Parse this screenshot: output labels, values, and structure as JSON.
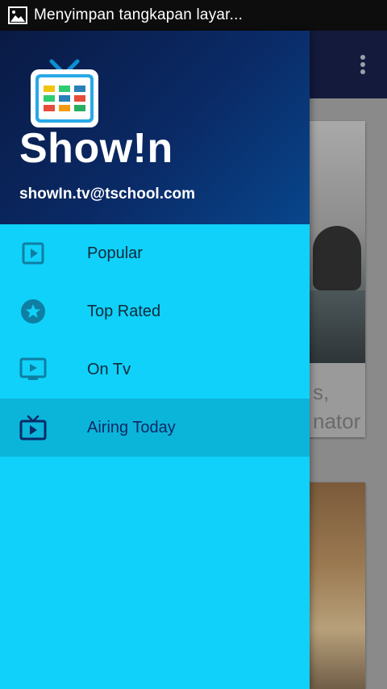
{
  "status_bar": {
    "notification_text": "Menyimpan tangkapan layar..."
  },
  "background": {
    "card_caption_lines": [
      "s,",
      "nator"
    ]
  },
  "drawer": {
    "app_name": "Show!n",
    "account_email": "showIn.tv@tschool.com",
    "items": [
      {
        "label": "Popular",
        "icon": "play-square-icon",
        "active": false
      },
      {
        "label": "Top Rated",
        "icon": "star-circle-icon",
        "active": false
      },
      {
        "label": "On Tv",
        "icon": "monitor-play-icon",
        "active": false
      },
      {
        "label": "Airing Today",
        "icon": "tv-antenna-icon",
        "active": true
      }
    ]
  },
  "colors": {
    "drawer_bg": "#10d1f9",
    "active_item_bg": "#0bb5da",
    "header_dark": "#0a1a44",
    "header_light": "#08468c",
    "icon_color": "#0e7fa3",
    "active_icon_color": "#0a2a66"
  }
}
